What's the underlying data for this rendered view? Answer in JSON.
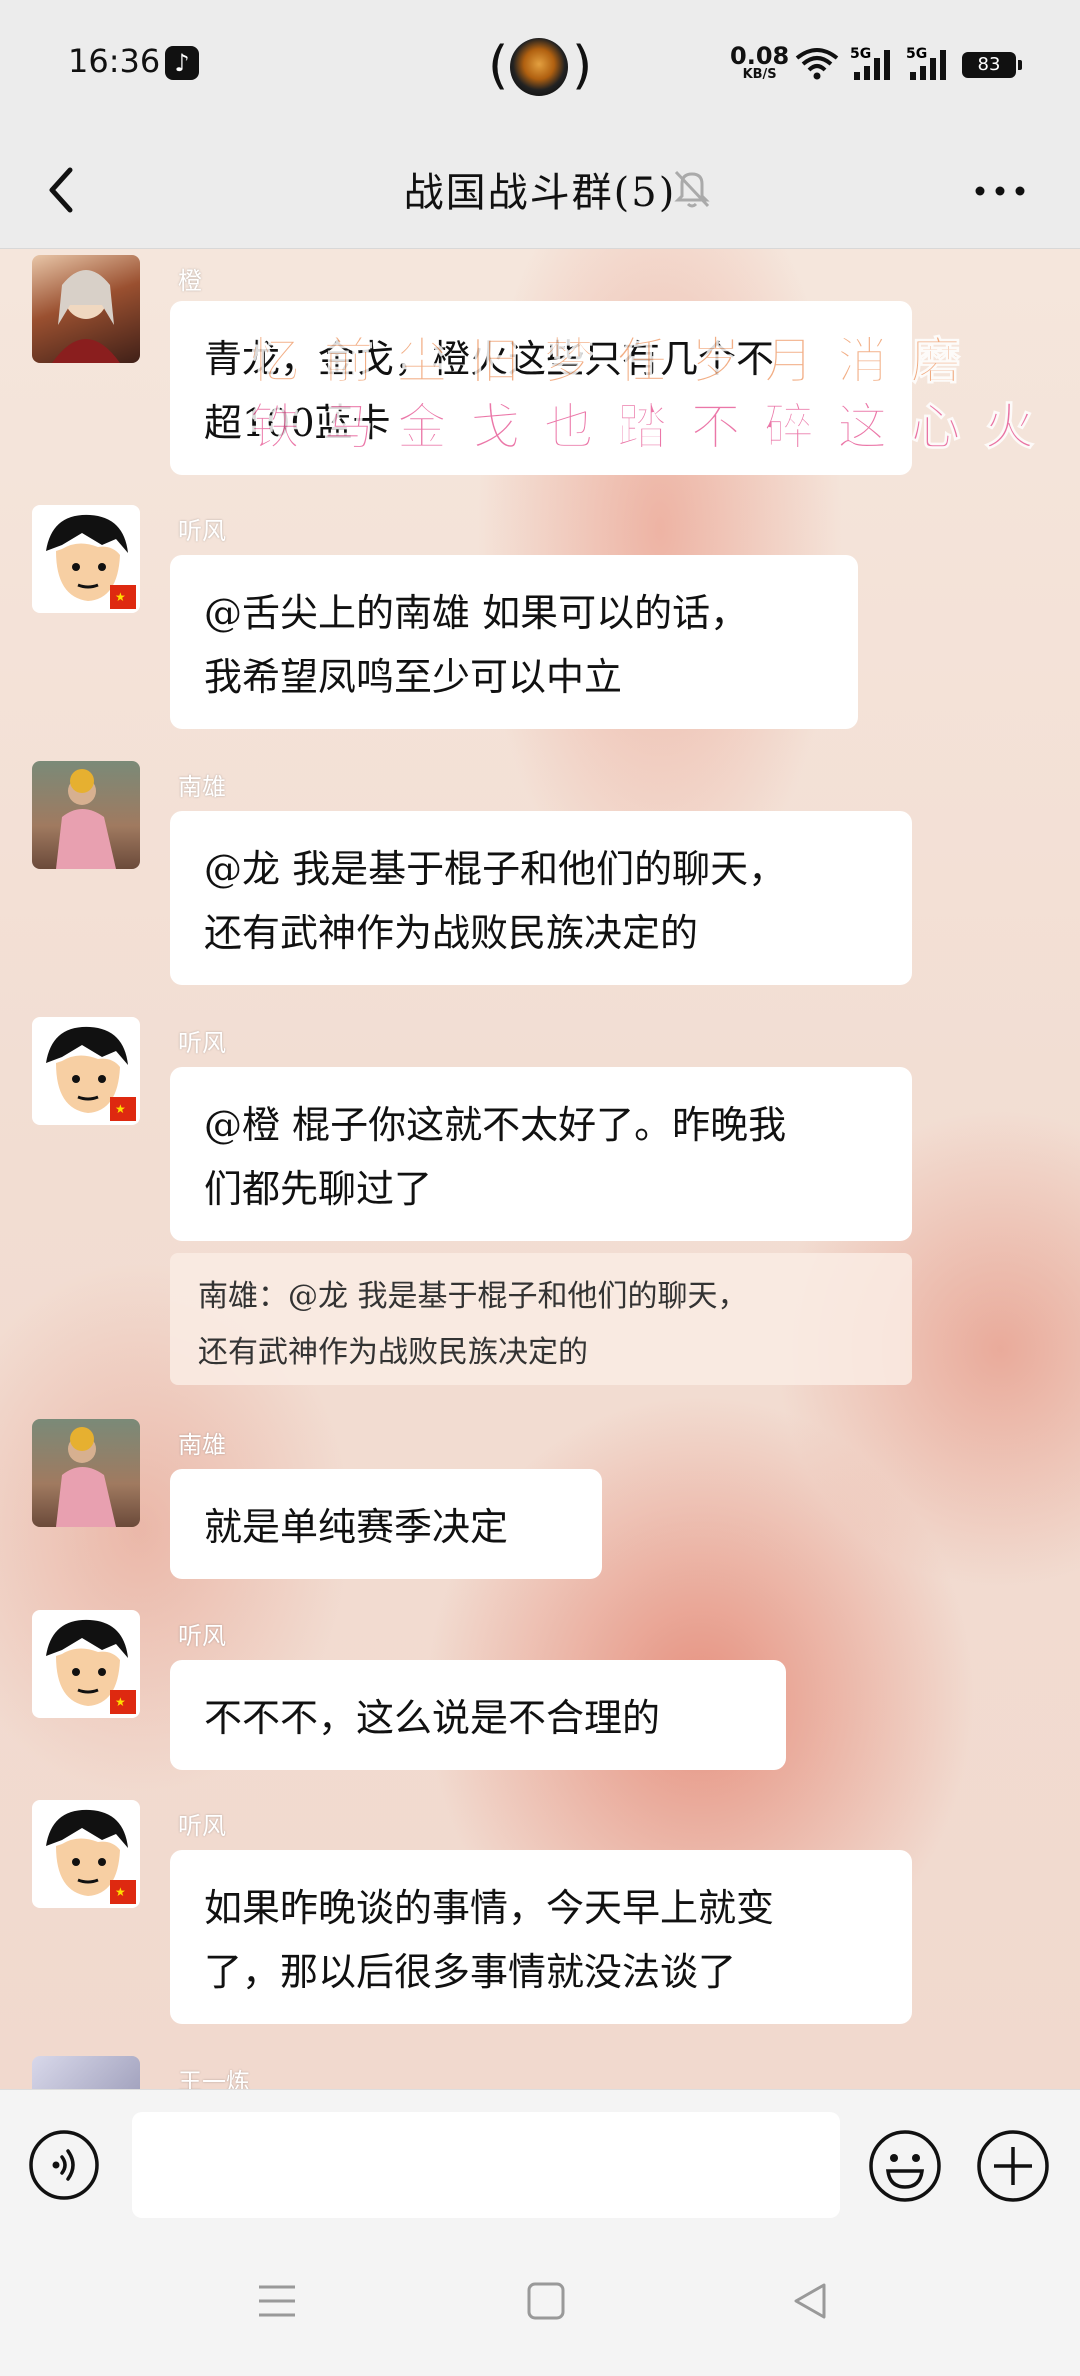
{
  "status": {
    "time": "16:36",
    "speed_value": "0.08",
    "speed_unit": "KB/S",
    "battery": "83",
    "sig1": "5G",
    "sig2": "5G",
    "tiktok_glyph": "♪"
  },
  "header": {
    "title": "战国战斗群(5)"
  },
  "overlay": {
    "line1": "忆 前 尘 旧 梦 任 岁 月 消 磨",
    "line2": "铁 马 金 戈 也 踏 不 碎 这 心 火",
    "line1_color": "#f0a070",
    "line2_color": "#e8609a"
  },
  "messages": [
    {
      "sender": "橙",
      "lines": [
        "青龙，金戈，橙火这些只有几个不",
        "超100蓝卡"
      ]
    },
    {
      "sender": "听风",
      "lines": [
        "@舌尖上的南雄  如果可以的话，",
        "我希望凤鸣至少可以中立"
      ]
    },
    {
      "sender": "南雄",
      "lines": [
        "@龙  我是基于棍子和他们的聊天，",
        "还有武神作为战败民族决定的"
      ]
    },
    {
      "sender": "听风",
      "lines": [
        "@橙 棍子你这就不太好了。昨晚我",
        "们都先聊过了"
      ],
      "quote": [
        "南雄：@龙 我是基于棍子和他们的聊天，",
        "还有武神作为战败民族决定的"
      ]
    },
    {
      "sender": "南雄",
      "lines": [
        "就是单纯赛季决定"
      ]
    },
    {
      "sender": "听风",
      "lines": [
        "不不不，这么说是不合理的"
      ]
    },
    {
      "sender": "听风",
      "lines": [
        "如果昨晚谈的事情，今天早上就变",
        "了，那以后很多事情就没法谈了"
      ]
    },
    {
      "sender": "王一炼"
    }
  ],
  "icons": {
    "back": "chevron-left-icon",
    "bell": "bell-muted-icon",
    "more": "more-dots-icon",
    "voice": "voice-icon",
    "emoji": "emoji-icon",
    "plus": "plus-icon"
  }
}
